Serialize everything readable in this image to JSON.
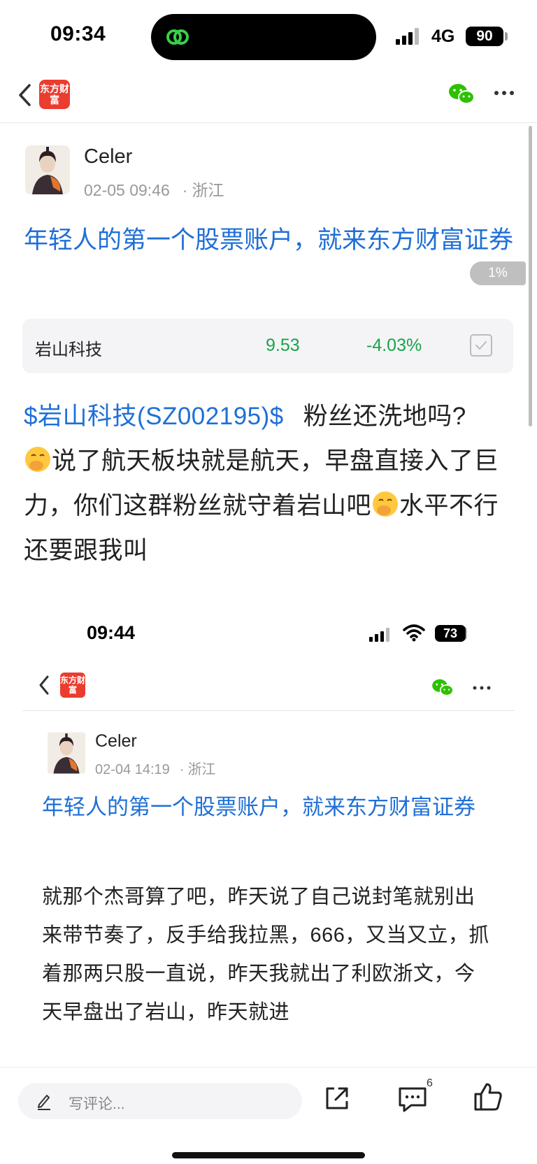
{
  "status_bar": {
    "time": "09:34",
    "network": "4G",
    "battery": "90"
  },
  "header": {
    "logo_text": "东方财富"
  },
  "post": {
    "author": "Celer",
    "date": "02-05 09:46",
    "location": "浙江",
    "title": "年轻人的第一个股票账户，就来东方财富证券",
    "read_progress": "1%",
    "stock": {
      "name": "岩山科技",
      "price": "9.53",
      "change": "-4.03%",
      "color": "#1aa34a"
    },
    "body": {
      "tag": "$岩山科技(SZ002195)$",
      "part1": "粉丝还洗地吗?",
      "part2": "说了航天板块就是航天，早盘直接入了巨力，你们这群粉丝就守着岩山吧",
      "part3": "水平不行还要跟我叫"
    }
  },
  "embedded_screenshot": {
    "time": "09:44",
    "battery": "73",
    "logo_text": "东方财富",
    "author": "Celer",
    "date": "02-04 14:19",
    "location": "浙江",
    "title": "年轻人的第一个股票账户，就来东方财富证券",
    "body": "就那个杰哥算了吧，昨天说了自己说封笔就别出来带节奏了，反手给我拉黑，666，又当又立，抓着那两只股一直说，昨天我就出了利欧浙文，今天早盘出了岩山，昨天就进"
  },
  "bottom_bar": {
    "comment_placeholder": "写评论...",
    "comment_count": "6"
  },
  "colors": {
    "link": "#1f6fd6",
    "brand": "#ea3d2f",
    "down": "#1aa34a"
  }
}
